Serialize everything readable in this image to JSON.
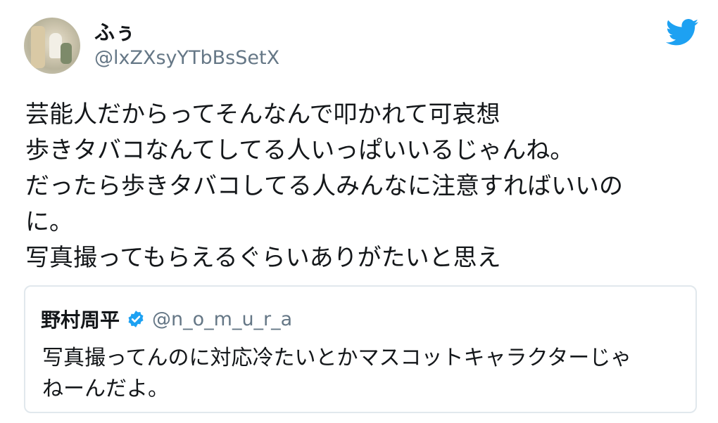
{
  "tweet": {
    "author": {
      "display_name": "ふぅ",
      "handle": "@lxZXsyYTbBsSetX",
      "avatar_icon": "user-avatar"
    },
    "brand_icon": "twitter-bird-icon",
    "brand_color": "#1da1f2",
    "text_lines": [
      "芸能人だからってそんなんで叩かれて可哀想",
      "歩きタバコなんてしてる人いっぱいいるじゃんね。",
      "だったら歩きタバコしてる人みんなに注意すればいいの",
      "に。",
      "写真撮ってもらえるぐらいありがたいと思え"
    ]
  },
  "quoted_tweet": {
    "display_name": "野村周平",
    "verified_icon": "verified-badge-icon",
    "handle": "@n_o_m_u_r_a",
    "text_lines": [
      "写真撮ってんのに対応冷たいとかマスコットキャラクターじゃ",
      "ねーんだよ。"
    ]
  },
  "colors": {
    "text": "#14171a",
    "secondary_text": "#657786",
    "border": "#e1e8ed",
    "accent": "#1da1f2"
  }
}
